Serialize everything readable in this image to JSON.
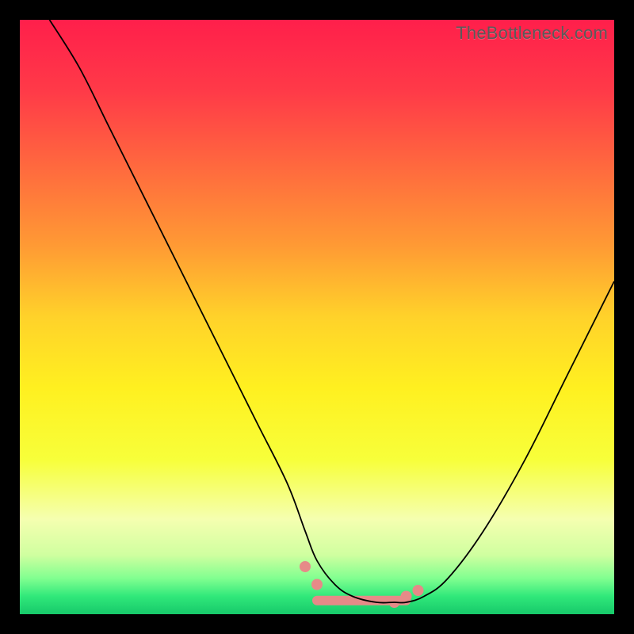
{
  "watermark": "TheBottleneck.com",
  "gradient": {
    "stops": [
      {
        "offset": 0.0,
        "color": "#ff1f4b"
      },
      {
        "offset": 0.12,
        "color": "#ff3a48"
      },
      {
        "offset": 0.25,
        "color": "#ff6a3e"
      },
      {
        "offset": 0.38,
        "color": "#ff9a34"
      },
      {
        "offset": 0.5,
        "color": "#ffd22a"
      },
      {
        "offset": 0.62,
        "color": "#fff020"
      },
      {
        "offset": 0.74,
        "color": "#f7ff3a"
      },
      {
        "offset": 0.84,
        "color": "#f5ffb0"
      },
      {
        "offset": 0.9,
        "color": "#d0ffa0"
      },
      {
        "offset": 0.94,
        "color": "#80ff90"
      },
      {
        "offset": 0.97,
        "color": "#30e87a"
      },
      {
        "offset": 1.0,
        "color": "#17c96a"
      }
    ]
  },
  "chart_data": {
    "type": "line",
    "title": "",
    "xlabel": "",
    "ylabel": "",
    "xlim": [
      0,
      100
    ],
    "ylim": [
      0,
      100
    ],
    "series": [
      {
        "name": "curve",
        "color": "#000000",
        "x": [
          5,
          10,
          15,
          20,
          25,
          30,
          35,
          40,
          45,
          48,
          50,
          53,
          56,
          60,
          63,
          65,
          68,
          72,
          78,
          85,
          92,
          100
        ],
        "y": [
          100,
          92,
          82,
          72,
          62,
          52,
          42,
          32,
          22,
          14,
          9,
          5,
          3,
          2,
          2,
          2,
          3,
          6,
          14,
          26,
          40,
          56
        ]
      }
    ],
    "highlight": {
      "color": "#e68a88",
      "dots_x": [
        48,
        50,
        63,
        65,
        67
      ],
      "dots_y": [
        8,
        5,
        2,
        3,
        4
      ],
      "bar_x0": 50,
      "bar_x1": 65,
      "bar_y": 2.3
    }
  }
}
